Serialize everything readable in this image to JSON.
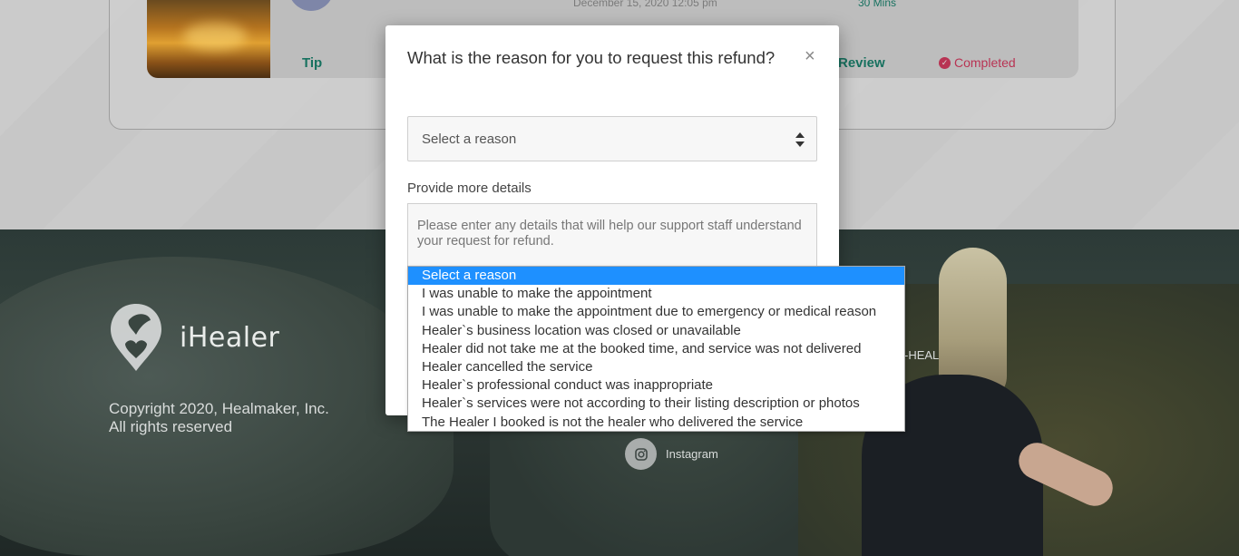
{
  "background_page": {
    "booking": {
      "date": "December 15, 2020 12:05 pm",
      "duration": "30 Mins",
      "tip_label": "Tip",
      "review_label": "Review",
      "status": "Completed",
      "status_color": "#b83353"
    }
  },
  "footer": {
    "logo_name": "iHealer",
    "copyright_line1": "Copyright 2020, Healmaker, Inc.",
    "copyright_line2": "All rights reserved",
    "phone_fragment": "-HEAL",
    "instagram_label": "Instagram"
  },
  "modal": {
    "title": "What is the reason for you to request this refund?",
    "close_symbol": "×",
    "select": {
      "value": "Select a reason"
    },
    "details_label": "Provide more details",
    "details_placeholder": "Please enter any details that will help our support staff understand your request for refund."
  },
  "dropdown": {
    "selected_index": 0,
    "highlight_color": "#1e90ff",
    "options": [
      "Select a reason",
      "I was unable to make the appointment",
      "I was unable to make the appointment due to emergency or medical reason",
      "Healer`s business location was closed or unavailable",
      "Healer did not take me at the booked time, and service was not delivered",
      "Healer cancelled the service",
      "Healer`s professional conduct was inappropriate",
      "Healer`s services were not according to their listing description or photos",
      "The Healer I booked is not the healer who delivered the service"
    ]
  },
  "colors": {
    "accent_green": "#17715f",
    "overlay_grey": "#b9b9b9"
  }
}
